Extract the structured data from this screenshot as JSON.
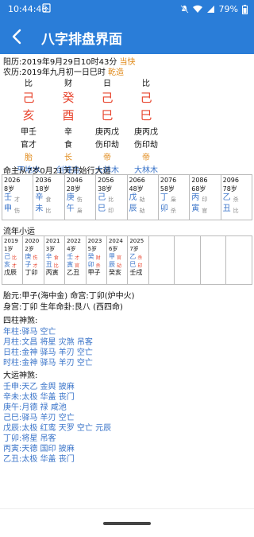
{
  "status_bar": {
    "time": "10:44:46",
    "battery": "79%"
  },
  "app_bar": {
    "title": "八字排盘界面"
  },
  "solar": {
    "label": "阳历:2019年9月29日10时43分",
    "mode": "当快"
  },
  "lunar": {
    "label": "农历:2019年九月初一日巳时",
    "gua": "乾造"
  },
  "pillars": [
    {
      "ten": "比",
      "stem": "己",
      "branch": "亥",
      "hidden": "甲壬",
      "gods": "官才",
      "state": "胎",
      "nayin": "平地木"
    },
    {
      "ten": "财",
      "stem": "癸",
      "branch": "酉",
      "hidden": "辛",
      "gods": "食",
      "state": "长",
      "nayin": "剑锋金"
    },
    {
      "ten": "日",
      "stem": "己",
      "branch": "巳",
      "hidden": "庚丙戊",
      "gods": "伤印劫",
      "state": "帝",
      "nayin": "大林木"
    },
    {
      "ten": "比",
      "stem": "己",
      "branch": "巳",
      "hidden": "庚丙戊",
      "gods": "伤印劫",
      "state": "帝",
      "nayin": "大林木"
    }
  ],
  "dayun_title": "命主从7岁0月21天开始行大运",
  "dayun": [
    {
      "year": "2026",
      "age": "8岁",
      "g1": "壬",
      "g1s": "才",
      "g2": "申",
      "g2s": "伤"
    },
    {
      "year": "2036",
      "age": "18岁",
      "g1": "辛",
      "g1s": "食",
      "g2": "未",
      "g2s": "比"
    },
    {
      "year": "2046",
      "age": "28岁",
      "g1": "庚",
      "g1s": "伤",
      "g2": "午",
      "g2s": "枭"
    },
    {
      "year": "2056",
      "age": "38岁",
      "g1": "己",
      "g1s": "比",
      "g2": "巳",
      "g2s": "印"
    },
    {
      "year": "2066",
      "age": "48岁",
      "g1": "戊",
      "g1s": "劫",
      "g2": "辰",
      "g2s": "劫"
    },
    {
      "year": "2076",
      "age": "58岁",
      "g1": "丁",
      "g1s": "枭",
      "g2": "卯",
      "g2s": "杀"
    },
    {
      "year": "2086",
      "age": "68岁",
      "g1": "丙",
      "g1s": "印",
      "g2": "寅",
      "g2s": "官"
    },
    {
      "year": "2096",
      "age": "78岁",
      "g1": "乙",
      "g1s": "杀",
      "g2": "丑",
      "g2s": "比"
    }
  ],
  "liunian_title": "流年小运",
  "liunian": [
    {
      "year": "2019",
      "age": "1岁",
      "g1": "己",
      "g1s": "比",
      "g2": "亥",
      "g2s": "才",
      "xy": "戊辰"
    },
    {
      "year": "2020",
      "age": "2岁",
      "g1": "庚",
      "g1s": "伤",
      "g2": "子",
      "g2s": "才",
      "xy": "丁卯"
    },
    {
      "year": "2021",
      "age": "3岁",
      "g1": "辛",
      "g1s": "食",
      "g2": "丑",
      "g2s": "比",
      "xy": "丙寅"
    },
    {
      "year": "2022",
      "age": "4岁",
      "g1": "壬",
      "g1s": "才",
      "g2": "寅",
      "g2s": "官",
      "xy": "乙丑"
    },
    {
      "year": "2023",
      "age": "5岁",
      "g1": "癸",
      "g1s": "财",
      "g2": "卯",
      "g2s": "杀",
      "xy": "甲子"
    },
    {
      "year": "2024",
      "age": "6岁",
      "g1": "甲",
      "g1s": "官",
      "g2": "辰",
      "g2s": "劫",
      "xy": "癸亥"
    },
    {
      "year": "2025",
      "age": "7岁",
      "g1": "乙",
      "g1s": "杀",
      "g2": "巳",
      "g2s": "印",
      "xy": "壬戌"
    }
  ],
  "taiyuan": "胎元:甲子(海中金)   命宫:丁卯(炉中火)",
  "shengong": "身宫:丁卯   生年命卦:艮八 (西四命)",
  "sizhu_title": "四柱神煞:",
  "sizhu_lines": [
    {
      "label": "年柱:",
      "text": "驿马 空亡"
    },
    {
      "label": "月柱:",
      "text": "文昌 将星 灾煞 吊客"
    },
    {
      "label": "日柱:",
      "text": "金神 驿马 羊刃 空亡"
    },
    {
      "label": "时柱:",
      "text": "金神 驿马 羊刃 空亡"
    }
  ],
  "dayun_ss_title": "大运神煞:",
  "dayun_ss_lines": [
    {
      "label": "壬申:",
      "text": "天乙 金舆 披麻"
    },
    {
      "label": "辛未:",
      "text": "太极 华盖 丧门"
    },
    {
      "label": "庚午:",
      "text": "月德 禄 咸池"
    },
    {
      "label": "己巳:",
      "text": "驿马 羊刃 空亡"
    },
    {
      "label": "戊辰:",
      "text": "太极 红鸾 天罗 空亡 元辰"
    },
    {
      "label": "丁卯:",
      "text": "将星 吊客"
    },
    {
      "label": "丙寅:",
      "text": "天德 国印 披麻"
    },
    {
      "label": "乙丑:",
      "text": "太极 华盖 丧门"
    }
  ]
}
